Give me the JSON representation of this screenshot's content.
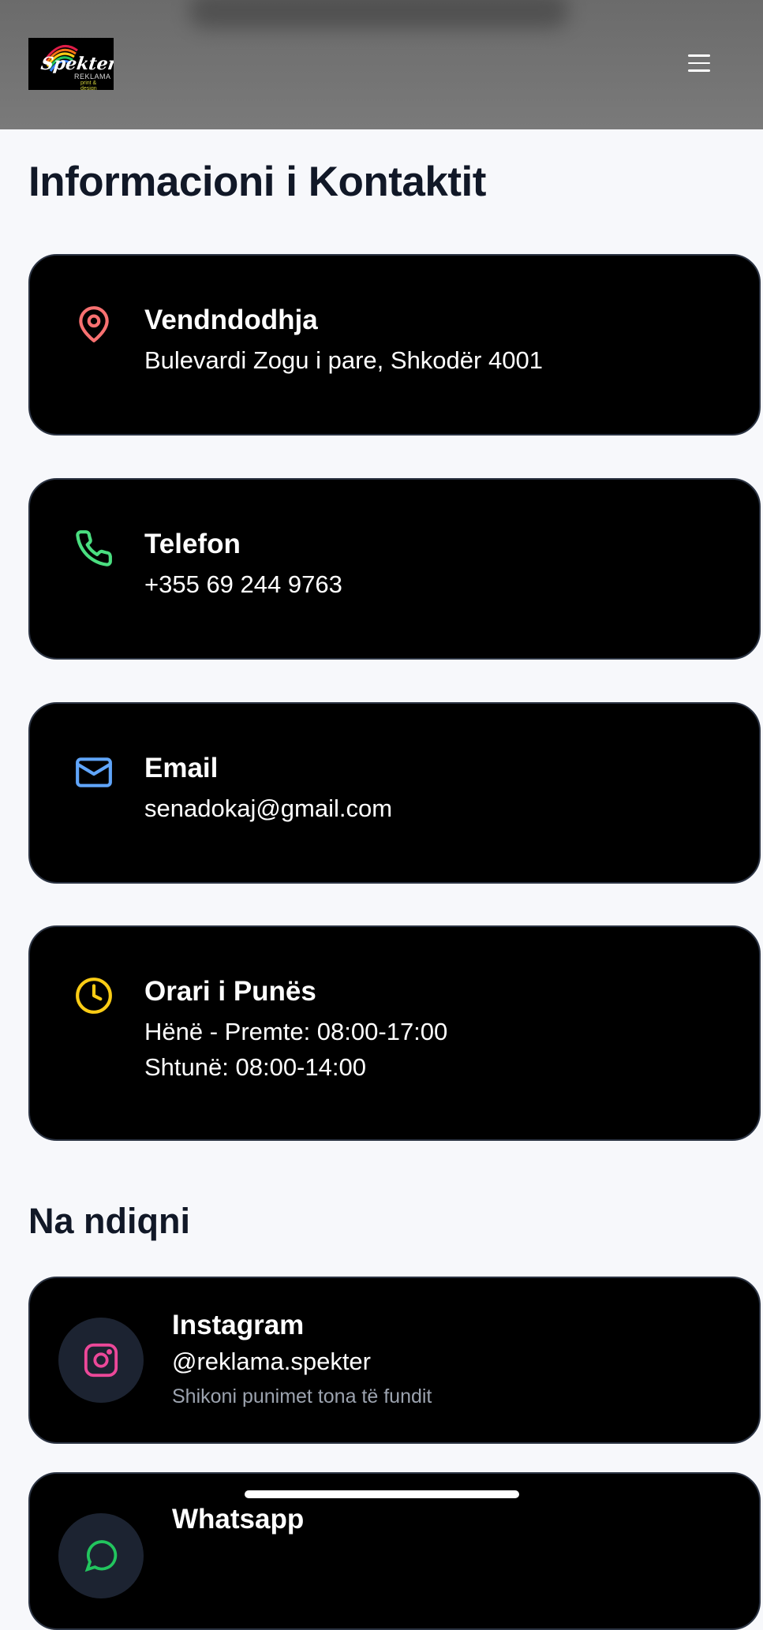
{
  "header": {
    "logo_text": "Spekter",
    "logo_sub": "REKLAMA",
    "logo_tag": "print & design",
    "menu_icon": "hamburger-menu-icon"
  },
  "page_title": "Informacioni i Kontaktit",
  "contact_cards": [
    {
      "icon": "map-pin-icon",
      "color": "#f87171",
      "title": "Vendndodhja",
      "value": "Bulevardi Zogu i pare, Shkodër 4001"
    },
    {
      "icon": "phone-icon",
      "color": "#4ade80",
      "title": "Telefon",
      "value": "+355 69 244 9763"
    },
    {
      "icon": "mail-icon",
      "color": "#60a5fa",
      "title": "Email",
      "value": "senadokaj@gmail.com"
    },
    {
      "icon": "clock-icon",
      "color": "#facc15",
      "title": "Orari i Punës",
      "value_line1": "Hënë - Premte: 08:00-17:00",
      "value_line2": "Shtunë: 08:00-14:00"
    }
  ],
  "follow_title": "Na ndiqni",
  "social": [
    {
      "icon": "instagram-icon",
      "color": "#ec4899",
      "title": "Instagram",
      "handle": "@reklama.spekter",
      "desc": "Shikoni punimet tona të fundit"
    },
    {
      "icon": "whatsapp-icon",
      "color": "#22c55e",
      "title": "Whatsapp"
    }
  ]
}
